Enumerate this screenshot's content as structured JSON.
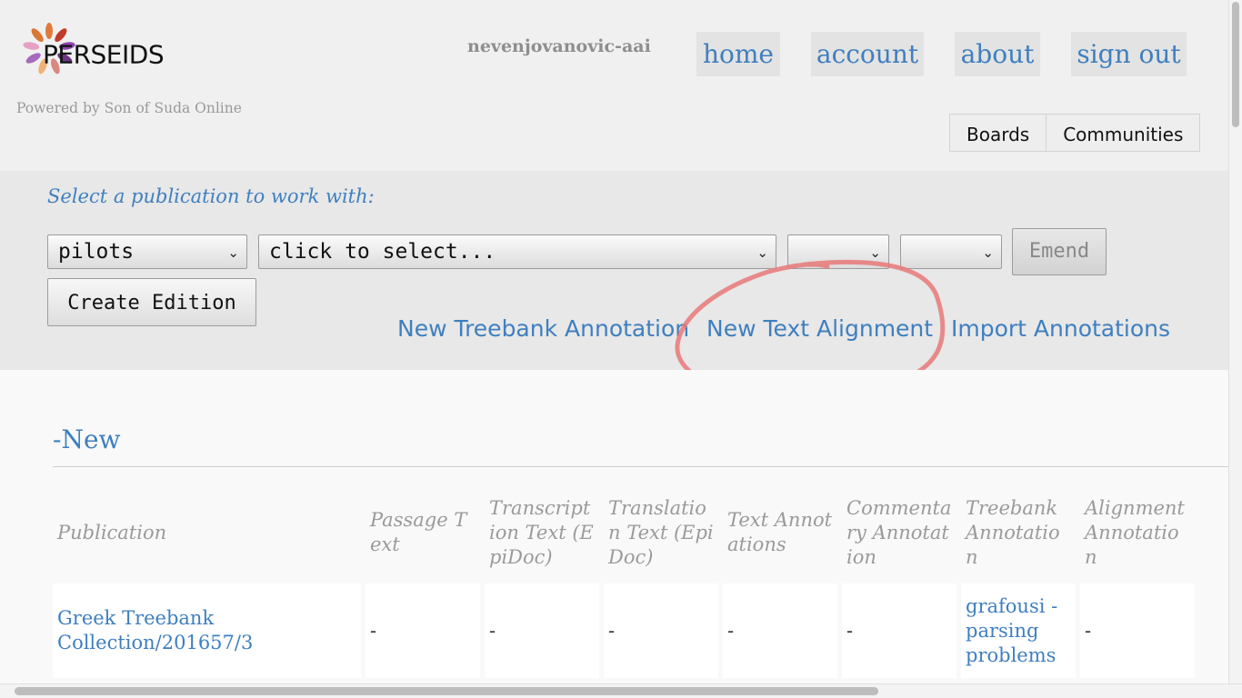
{
  "header": {
    "logo_text": "PERSEIDS",
    "powered_by": "Powered by Son of Suda Online",
    "username": "nevenjovanovic-aai",
    "nav": [
      {
        "label": "home"
      },
      {
        "label": "account"
      },
      {
        "label": "about"
      },
      {
        "label": "sign out"
      }
    ],
    "tabs": [
      {
        "label": "Boards"
      },
      {
        "label": "Communities"
      }
    ]
  },
  "publication_select": {
    "title": "Select a publication to work with:",
    "collection_value": "pilots",
    "item_value": "click to select...",
    "filter1_value": "",
    "filter2_value": "",
    "emend_label": "Emend",
    "create_edition_label": "Create Edition",
    "links": [
      {
        "label": "New Treebank Annotation"
      },
      {
        "label": "New Text Alignment"
      },
      {
        "label": "Import Annotations"
      }
    ]
  },
  "section": {
    "title": "-New",
    "columns": [
      "Publication",
      "Passage Text",
      "Transcription Text (EpiDoc)",
      "Translation Text (EpiDoc)",
      "Text Annotations",
      "Commentary Annotation",
      "Treebank Annotation",
      "Alignment Annotation"
    ],
    "rows": [
      {
        "publication": "Greek Treebank Collection/201657/3",
        "passage": "-",
        "transcription": "-",
        "translation": "-",
        "text_annotations": "-",
        "commentary": "-",
        "treebank": "grafousi - parsing problems",
        "alignment": "-"
      }
    ]
  },
  "colors": {
    "link": "#3f7fbf",
    "muted": "#9a9a9a",
    "highlight_circle": "#e87878"
  }
}
